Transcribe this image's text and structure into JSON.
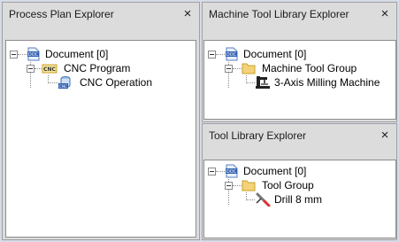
{
  "process_plan": {
    "title": "Process Plan Explorer",
    "close": "×",
    "tree": {
      "root": "Document [0]",
      "group": "CNC Program",
      "item": "CNC Operation"
    }
  },
  "machine_library": {
    "title": "Machine Tool Library Explorer",
    "close": "×",
    "tree": {
      "root": "Document [0]",
      "group": "Machine Tool Group",
      "item": "3-Axis Milling Machine"
    }
  },
  "tool_library": {
    "title": "Tool Library Explorer",
    "close": "×",
    "tree": {
      "root": "Document [0]",
      "group": "Tool Group",
      "item": "Drill 8 mm"
    }
  },
  "icons": {
    "doc_badge": "DOC",
    "cnc_badge": "CNC",
    "folder_color": "#f4d27a"
  }
}
